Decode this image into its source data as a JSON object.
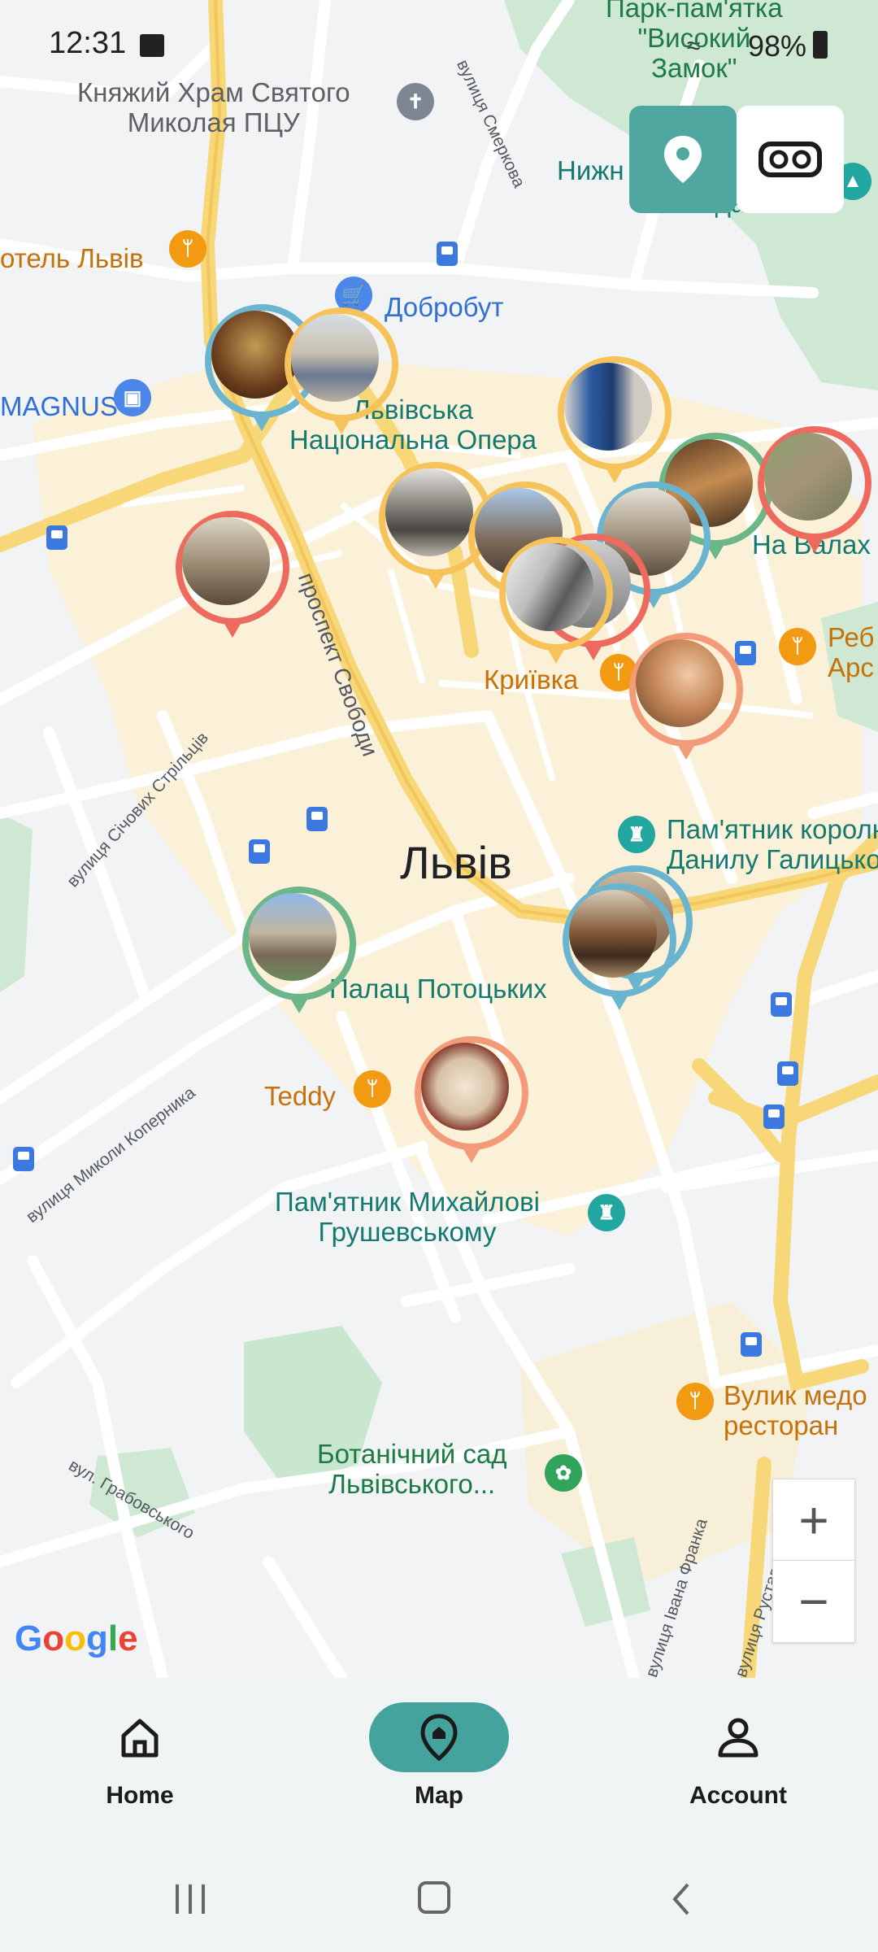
{
  "status_bar": {
    "time": "12:31",
    "battery": "98%"
  },
  "map": {
    "city_label": "Львів",
    "labels": {
      "park_high_castle": "Парк-пам'ятка\n\"Високий\nЗамок\"",
      "church": "Княжий Храм Святого\nМиколая ПЦУ",
      "street_smerekova": "вулиця Смеркова",
      "nyzh_partial": "Нижн",
      "maidanchyk": "Майданчик",
      "hotel_lviv": "отель Львів",
      "dobrobut": "Добробут",
      "magnus": "MAGNUS",
      "opera": "Львівська\nНаціональна Опера",
      "na_valakh": "На Валах",
      "reb": "Реб\nАрс",
      "kryivka": "Криївка",
      "prospekt_svobody": "проспект Свободи",
      "vul_sichovykh": "вулиця Січових Стрільців",
      "monument_danylo": "Пам'ятник королю\nДанилу Галицькому",
      "palace_pototskykh": "Палац Потоцьких",
      "teddy": "Teddy",
      "vul_kopernyka": "вулиця Миколи Коперника",
      "monument_hrushevsky": "Пам'ятник Михайлові\nГрушевському",
      "vulyk": "Вулик медо\nресторан",
      "botanic_garden": "Ботанічний сад\nЛьвівського...",
      "vul_hrabovskoho": "вул. Грабовського",
      "vul_ivana_franka": "вулиця Івана Франка",
      "vul_rustaveli": "вулиця Руставелі"
    },
    "google_logo": "Google",
    "zoom_in": "+",
    "zoom_out": "−"
  },
  "floating_buttons": {
    "location_icon": "location-pin-icon",
    "vr_icon": "vr-headset-icon"
  },
  "bottom_nav": {
    "items": [
      {
        "label": "Home",
        "icon": "home-icon"
      },
      {
        "label": "Map",
        "icon": "map-pin-icon"
      },
      {
        "label": "Account",
        "icon": "person-icon"
      }
    ],
    "active": "Map"
  },
  "colors": {
    "accent": "#44a39c",
    "marker_yellow": "#f6c35b",
    "marker_blue": "#6bb4cf",
    "marker_red": "#ec6a5e",
    "marker_green": "#6cb68a",
    "marker_salmon": "#f39a78"
  }
}
